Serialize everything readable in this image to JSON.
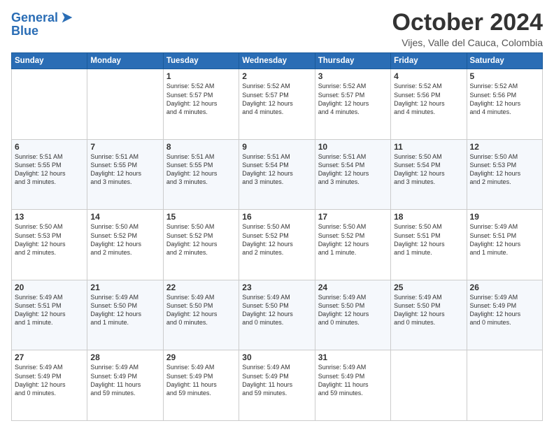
{
  "logo": {
    "line1": "General",
    "line2": "Blue"
  },
  "header": {
    "title": "October 2024",
    "location": "Vijes, Valle del Cauca, Colombia"
  },
  "weekdays": [
    "Sunday",
    "Monday",
    "Tuesday",
    "Wednesday",
    "Thursday",
    "Friday",
    "Saturday"
  ],
  "weeks": [
    [
      {
        "day": "",
        "info": ""
      },
      {
        "day": "",
        "info": ""
      },
      {
        "day": "1",
        "info": "Sunrise: 5:52 AM\nSunset: 5:57 PM\nDaylight: 12 hours\nand 4 minutes."
      },
      {
        "day": "2",
        "info": "Sunrise: 5:52 AM\nSunset: 5:57 PM\nDaylight: 12 hours\nand 4 minutes."
      },
      {
        "day": "3",
        "info": "Sunrise: 5:52 AM\nSunset: 5:57 PM\nDaylight: 12 hours\nand 4 minutes."
      },
      {
        "day": "4",
        "info": "Sunrise: 5:52 AM\nSunset: 5:56 PM\nDaylight: 12 hours\nand 4 minutes."
      },
      {
        "day": "5",
        "info": "Sunrise: 5:52 AM\nSunset: 5:56 PM\nDaylight: 12 hours\nand 4 minutes."
      }
    ],
    [
      {
        "day": "6",
        "info": "Sunrise: 5:51 AM\nSunset: 5:55 PM\nDaylight: 12 hours\nand 3 minutes."
      },
      {
        "day": "7",
        "info": "Sunrise: 5:51 AM\nSunset: 5:55 PM\nDaylight: 12 hours\nand 3 minutes."
      },
      {
        "day": "8",
        "info": "Sunrise: 5:51 AM\nSunset: 5:55 PM\nDaylight: 12 hours\nand 3 minutes."
      },
      {
        "day": "9",
        "info": "Sunrise: 5:51 AM\nSunset: 5:54 PM\nDaylight: 12 hours\nand 3 minutes."
      },
      {
        "day": "10",
        "info": "Sunrise: 5:51 AM\nSunset: 5:54 PM\nDaylight: 12 hours\nand 3 minutes."
      },
      {
        "day": "11",
        "info": "Sunrise: 5:50 AM\nSunset: 5:54 PM\nDaylight: 12 hours\nand 3 minutes."
      },
      {
        "day": "12",
        "info": "Sunrise: 5:50 AM\nSunset: 5:53 PM\nDaylight: 12 hours\nand 2 minutes."
      }
    ],
    [
      {
        "day": "13",
        "info": "Sunrise: 5:50 AM\nSunset: 5:53 PM\nDaylight: 12 hours\nand 2 minutes."
      },
      {
        "day": "14",
        "info": "Sunrise: 5:50 AM\nSunset: 5:52 PM\nDaylight: 12 hours\nand 2 minutes."
      },
      {
        "day": "15",
        "info": "Sunrise: 5:50 AM\nSunset: 5:52 PM\nDaylight: 12 hours\nand 2 minutes."
      },
      {
        "day": "16",
        "info": "Sunrise: 5:50 AM\nSunset: 5:52 PM\nDaylight: 12 hours\nand 2 minutes."
      },
      {
        "day": "17",
        "info": "Sunrise: 5:50 AM\nSunset: 5:52 PM\nDaylight: 12 hours\nand 1 minute."
      },
      {
        "day": "18",
        "info": "Sunrise: 5:50 AM\nSunset: 5:51 PM\nDaylight: 12 hours\nand 1 minute."
      },
      {
        "day": "19",
        "info": "Sunrise: 5:49 AM\nSunset: 5:51 PM\nDaylight: 12 hours\nand 1 minute."
      }
    ],
    [
      {
        "day": "20",
        "info": "Sunrise: 5:49 AM\nSunset: 5:51 PM\nDaylight: 12 hours\nand 1 minute."
      },
      {
        "day": "21",
        "info": "Sunrise: 5:49 AM\nSunset: 5:50 PM\nDaylight: 12 hours\nand 1 minute."
      },
      {
        "day": "22",
        "info": "Sunrise: 5:49 AM\nSunset: 5:50 PM\nDaylight: 12 hours\nand 0 minutes."
      },
      {
        "day": "23",
        "info": "Sunrise: 5:49 AM\nSunset: 5:50 PM\nDaylight: 12 hours\nand 0 minutes."
      },
      {
        "day": "24",
        "info": "Sunrise: 5:49 AM\nSunset: 5:50 PM\nDaylight: 12 hours\nand 0 minutes."
      },
      {
        "day": "25",
        "info": "Sunrise: 5:49 AM\nSunset: 5:50 PM\nDaylight: 12 hours\nand 0 minutes."
      },
      {
        "day": "26",
        "info": "Sunrise: 5:49 AM\nSunset: 5:49 PM\nDaylight: 12 hours\nand 0 minutes."
      }
    ],
    [
      {
        "day": "27",
        "info": "Sunrise: 5:49 AM\nSunset: 5:49 PM\nDaylight: 12 hours\nand 0 minutes."
      },
      {
        "day": "28",
        "info": "Sunrise: 5:49 AM\nSunset: 5:49 PM\nDaylight: 11 hours\nand 59 minutes."
      },
      {
        "day": "29",
        "info": "Sunrise: 5:49 AM\nSunset: 5:49 PM\nDaylight: 11 hours\nand 59 minutes."
      },
      {
        "day": "30",
        "info": "Sunrise: 5:49 AM\nSunset: 5:49 PM\nDaylight: 11 hours\nand 59 minutes."
      },
      {
        "day": "31",
        "info": "Sunrise: 5:49 AM\nSunset: 5:49 PM\nDaylight: 11 hours\nand 59 minutes."
      },
      {
        "day": "",
        "info": ""
      },
      {
        "day": "",
        "info": ""
      }
    ]
  ]
}
